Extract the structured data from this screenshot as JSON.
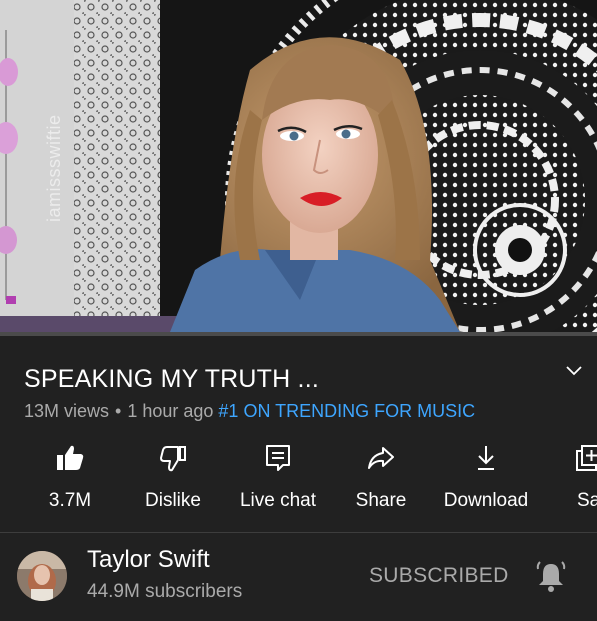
{
  "video": {
    "watermark": "iamissswiftie",
    "progress_fraction": 0.0
  },
  "info": {
    "title": "SPEAKING MY TRUTH ...",
    "views": "13M views",
    "separator": "•",
    "time_ago": "1 hour ago",
    "trending": "#1 ON TRENDING FOR MUSIC",
    "expand_icon": "chevron-down-icon"
  },
  "actions": [
    {
      "label": "3.7M",
      "icon": "thumbs-up-filled-icon"
    },
    {
      "label": "Dislike",
      "icon": "thumbs-down-icon"
    },
    {
      "label": "Live chat",
      "icon": "live-chat-icon"
    },
    {
      "label": "Share",
      "icon": "share-arrow-icon"
    },
    {
      "label": "Download",
      "icon": "download-icon"
    },
    {
      "label": "Sav",
      "icon": "save-playlist-icon"
    }
  ],
  "channel": {
    "name": "Taylor Swift",
    "subscribers": "44.9M subscribers",
    "subscribe_label": "SUBSCRIBED",
    "bell_icon": "notification-bell-ringing-icon"
  },
  "colors": {
    "background": "#212121",
    "accent_link": "#3ea6ff",
    "secondary_text": "#aaaaaa",
    "progress": "#cc0000"
  }
}
